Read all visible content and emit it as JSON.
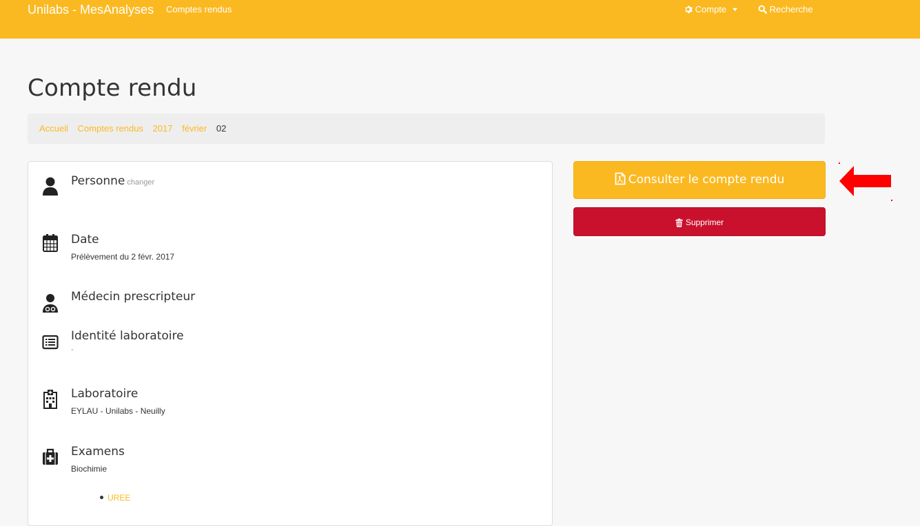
{
  "navbar": {
    "brand": "Unilabs - MesAnalyses",
    "link_reports": "Comptes rendus",
    "account": "Compte",
    "search": "Recherche"
  },
  "page": {
    "title": "Compte rendu"
  },
  "breadcrumb": [
    "Accueil",
    "Comptes rendus",
    "2017",
    "février",
    "02"
  ],
  "sections": {
    "personne": {
      "title": "Personne",
      "change": "changer",
      "icon": "user-icon"
    },
    "date": {
      "title": "Date",
      "value": "Prélèvement du 2 févr. 2017",
      "icon": "calendar-icon"
    },
    "medecin": {
      "title": "Médecin prescripteur",
      "icon": "user-md-icon"
    },
    "identite": {
      "title": "Identité laboratoire",
      "value": "-",
      "icon": "list-alt-icon"
    },
    "laboratoire": {
      "title": "Laboratoire",
      "value": "EYLAU - Unilabs - Neuilly",
      "icon": "hospital-icon"
    },
    "examens": {
      "title": "Examens",
      "category": "Biochimie",
      "items": [
        "UREE"
      ],
      "icon": "medkit-icon"
    }
  },
  "actions": {
    "consult": "Consulter le compte rendu",
    "delete": "Supprimer"
  },
  "colors": {
    "accent": "#fbb921",
    "danger": "#c9112e",
    "arrow": "#ff0000"
  }
}
